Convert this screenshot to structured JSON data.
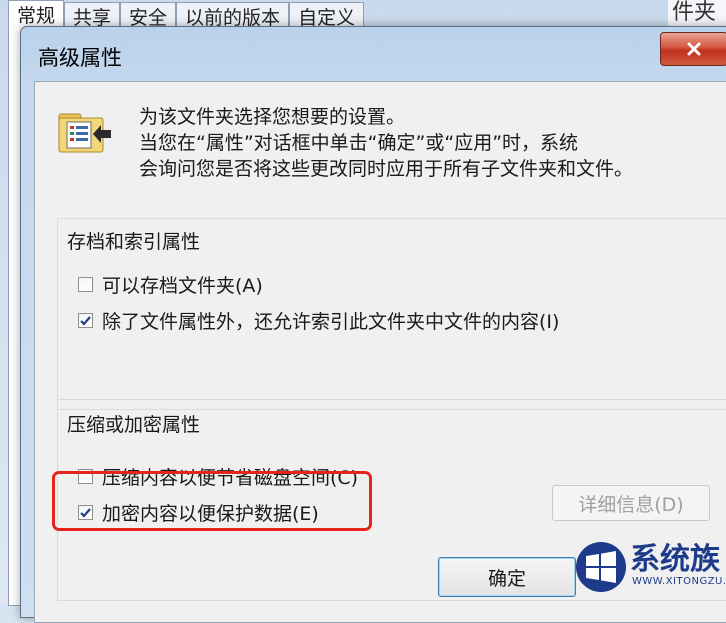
{
  "background_window": {
    "tabs": [
      "常规",
      "共享",
      "安全",
      "以前的版本",
      "自定义"
    ],
    "right_text": "件夹"
  },
  "dialog": {
    "title": "高级属性",
    "close_label": "✕",
    "intro_line1": "为该文件夹选择您想要的设置。",
    "intro_line2": "当您在“属性”对话框中单击“确定”或“应用”时，系统",
    "intro_line3": "会询问您是否将这些更改同时应用于所有子文件夹和文件。",
    "archive_group": {
      "title": "存档和索引属性",
      "options": [
        {
          "label": "可以存档文件夹(A)",
          "checked": false
        },
        {
          "label": "除了文件属性外，还允许索引此文件夹中文件的内容(I)",
          "checked": true
        }
      ]
    },
    "compress_group": {
      "title": "压缩或加密属性",
      "options": [
        {
          "label": "压缩内容以便节省磁盘空间(C)",
          "checked": false
        },
        {
          "label": "加密内容以便保护数据(E)",
          "checked": true
        }
      ],
      "details_button": "详细信息(D)"
    },
    "ok_button": "确定"
  },
  "watermark": {
    "text": "系统族",
    "url": "WWW.XITONGZU.COM"
  },
  "colors": {
    "highlight": "#e5251b",
    "titlebar": "#c4d8ee",
    "close": "#c1301b"
  }
}
